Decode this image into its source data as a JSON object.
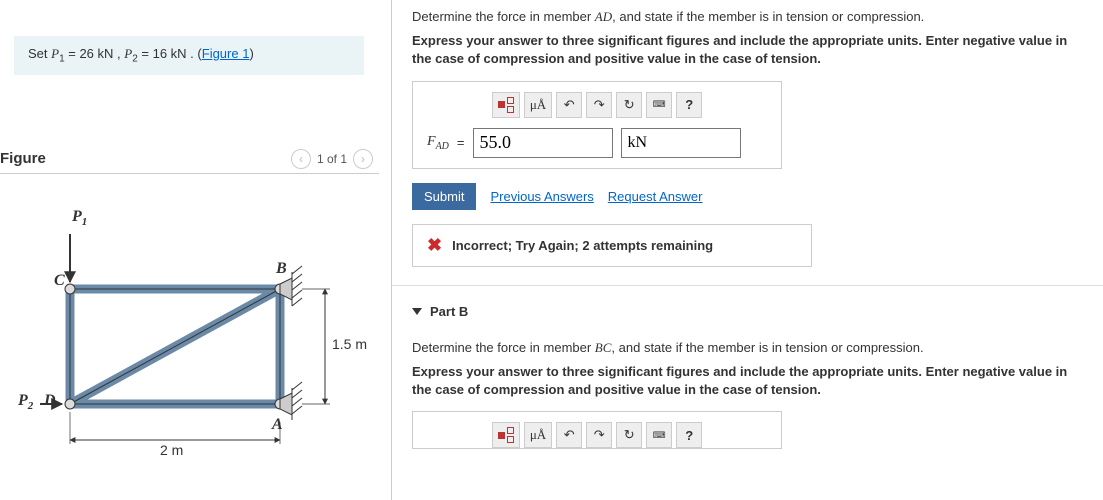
{
  "given": {
    "p1_var": "P",
    "p1_sub": "1",
    "p1_val": " = 26  kN",
    "sep": " , ",
    "p2_var": "P",
    "p2_sub": "2",
    "p2_val": " = 16  kN",
    "tail": " . ",
    "link_open": "(",
    "link_text": "Figure 1",
    "link_close": ")"
  },
  "figure_header": {
    "title": "Figure",
    "pager": "1 of 1"
  },
  "figure": {
    "P1": "P",
    "P1s": "1",
    "P2": "P",
    "P2s": "2",
    "C": "C",
    "B": "B",
    "D": "D",
    "A": "A",
    "h": "1.5 m",
    "w": "2 m"
  },
  "partA": {
    "prompt_pre": "Determine the force in member ",
    "member": "AD",
    "prompt_post": ", and state if the member is in tension or compression.",
    "instr": "Express your answer to three significant figures and include the appropriate units. Enter negative value in the case of compression and positive value in the case of tension.",
    "lhs_main": "F",
    "lhs_sub": "AD",
    "eq": " = ",
    "value": "55.0",
    "unit": "kN",
    "muA": "μÅ",
    "q": "?",
    "submit": "Submit",
    "prev": "Previous Answers",
    "req": "Request Answer",
    "feedback": "Incorrect; Try Again; 2 attempts remaining"
  },
  "partB": {
    "title": "Part B",
    "prompt_pre": "Determine the force in member ",
    "member": "BC",
    "prompt_post": ", and state if the member is in tension or compression.",
    "instr": "Express your answer to three significant figures and include the appropriate units. Enter negative value in the case of compression and positive value in the case of tension.",
    "muA": "μÅ",
    "q": "?"
  }
}
